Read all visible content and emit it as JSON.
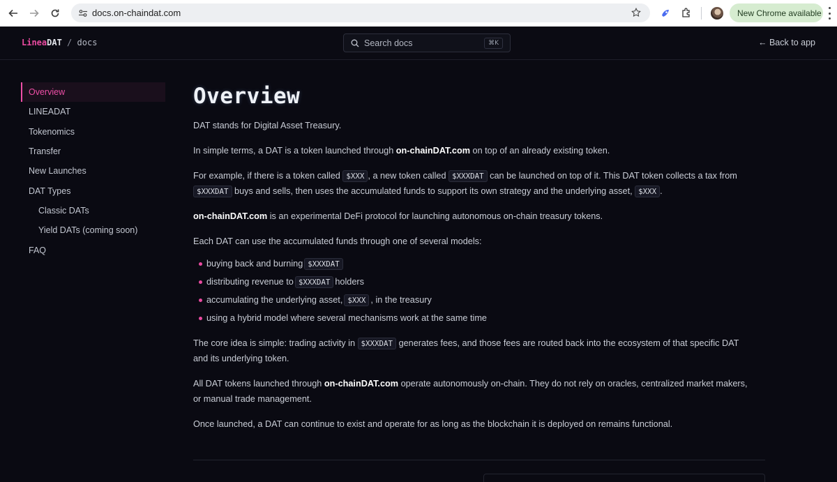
{
  "browser": {
    "url": "docs.on-chaindat.com",
    "update_label": "New Chrome available"
  },
  "header": {
    "brand_primary": "Linea",
    "brand_secondary": "DAT",
    "brand_separator": "/",
    "brand_section": "docs",
    "search_placeholder": "Search docs",
    "search_shortcut": "⌘K",
    "back_link": "← Back to app"
  },
  "sidebar": {
    "items": [
      {
        "label": "Overview"
      },
      {
        "label": "LINEADAT"
      },
      {
        "label": "Tokenomics"
      },
      {
        "label": "Transfer"
      },
      {
        "label": "New Launches"
      },
      {
        "label": "DAT Types"
      },
      {
        "label": "Classic DATs"
      },
      {
        "label": "Yield DATs (coming soon)"
      },
      {
        "label": "FAQ"
      }
    ]
  },
  "main": {
    "title": "Overview",
    "p1": "DAT stands for Digital Asset Treasury.",
    "p2": {
      "a": "In simple terms, a DAT is a token launched through ",
      "b": "on-chainDAT.com",
      "c": " on top of an already existing token."
    },
    "p3": {
      "a": "For example, if there is a token called ",
      "code1": "$XXX",
      "b": ", a new token called ",
      "code2": "$XXXDAT",
      "c": " can be launched on top of it. This DAT token collects a tax from",
      "code3": "$XXXDAT",
      "d": " buys and sells, then uses the accumulated funds to support its own strategy and the underlying asset, ",
      "code4": "$XXX",
      "e": "."
    },
    "p4": {
      "b": "on-chainDAT.com",
      "c": " is an experimental DeFi protocol for launching autonomous on-chain treasury tokens."
    },
    "p5": "Each DAT can use the accumulated funds through one of several models:",
    "bullets": [
      {
        "a": "buying back and burning ",
        "code": "$XXXDAT",
        "b": ""
      },
      {
        "a": "distributing revenue to ",
        "code": "$XXXDAT",
        "b": " holders"
      },
      {
        "a": "accumulating the underlying asset, ",
        "code": "$XXX",
        "b": ", in the treasury"
      },
      {
        "a": "using a hybrid model where several mechanisms work at the same time",
        "code": "",
        "b": ""
      }
    ],
    "p6": {
      "a": "The core idea is simple: trading activity in ",
      "code": "$XXXDAT",
      "b": " generates fees, and those fees are routed back into the ecosystem of that specific DAT",
      "c": "and its underlying token."
    },
    "p7": {
      "a": "All DAT tokens launched through ",
      "b": "on-chainDAT.com",
      "c": " operate autonomously on-chain. They do not rely on oracles, centralized market makers,",
      "d": "or manual trade management."
    },
    "p8": "Once launched, a DAT can continue to exist and operate for as long as the blockchain it is deployed on remains functional."
  },
  "colors": {
    "accent": "#e94aa0",
    "background": "#0a0a12",
    "text": "#c9cdd6"
  }
}
